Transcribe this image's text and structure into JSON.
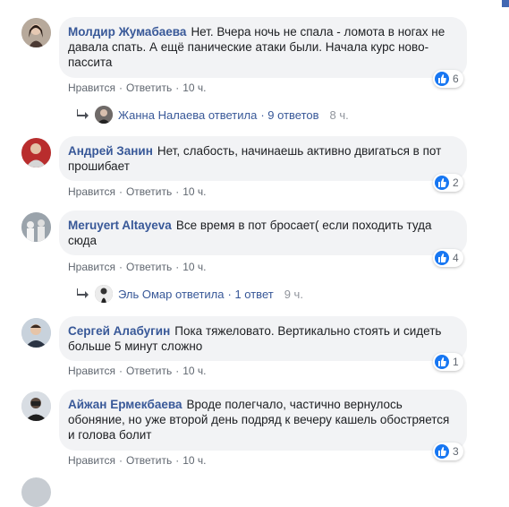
{
  "comments": [
    {
      "author": "Молдир Жумабаева",
      "text": "Нет. Вчера ночь не спала - ломота в ногах не давала спать. А ещё панические атаки были. Начала курс ново-пассита",
      "like": "Нравится",
      "reply": "Ответить",
      "time": "10 ч.",
      "reactions": "6",
      "reply_summary": {
        "name": "Жанна Налаева ответила",
        "count": "· 9 ответов",
        "time": "8 ч."
      }
    },
    {
      "author": "Андрей Занин",
      "text": "Нет, слабость, начинаешь активно двигаться в пот прошибает",
      "like": "Нравится",
      "reply": "Ответить",
      "time": "10 ч.",
      "reactions": "2"
    },
    {
      "author": "Meruyert Altayeva",
      "text": "Все время в пот бросает( если походить туда сюда",
      "like": "Нравится",
      "reply": "Ответить",
      "time": "10 ч.",
      "reactions": "4",
      "reply_summary": {
        "name": "Эль Омар ответила",
        "count": "· 1 ответ",
        "time": "9 ч."
      }
    },
    {
      "author": "Сергей Алабугин",
      "text": "Пока тяжеловато. Вертикально стоять и сидеть больше 5 минут сложно",
      "like": "Нравится",
      "reply": "Ответить",
      "time": "10 ч.",
      "reactions": "1"
    },
    {
      "author": "Айжан Ермекбаева",
      "text": "Вроде полегчало, частично вернулось обоняние, но уже второй день подряд к вечеру кашель обостряется и голова болит",
      "like": "Нравится",
      "reply": "Ответить",
      "time": "10 ч.",
      "reactions": "3"
    }
  ],
  "colors": {
    "author": "#385898",
    "bubble": "#f2f3f5",
    "like": "#1877f2",
    "meta": "#606770"
  },
  "icons": {
    "reaction": "like-thumb-icon",
    "reply": "reply-arrow-icon"
  }
}
